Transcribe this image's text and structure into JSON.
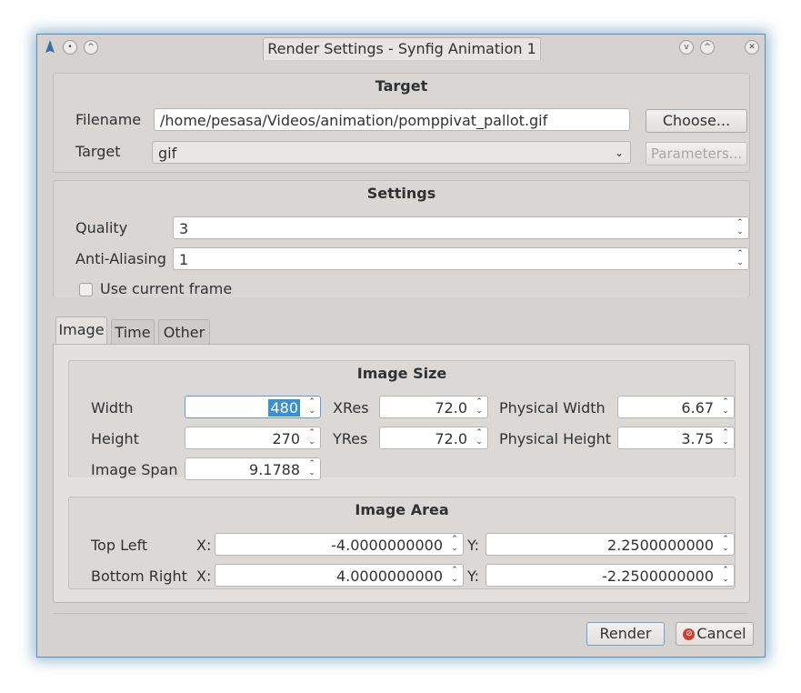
{
  "window": {
    "title": "Render Settings - Synfig Animation 1",
    "accent": "#5b8fbf"
  },
  "target_section": {
    "title": "Target",
    "filename_label": "Filename",
    "filename_value": "/home/pesasa/Videos/animation/pomppivat_pallot.gif",
    "choose_label": "Choose...",
    "target_label": "Target",
    "target_value": "gif",
    "parameters_label": "Parameters..."
  },
  "settings_section": {
    "title": "Settings",
    "quality_label": "Quality",
    "quality_value": "3",
    "antialiasing_label": "Anti-Aliasing",
    "antialiasing_value": "1",
    "use_current_frame_label": "Use current frame",
    "use_current_frame_checked": false
  },
  "tabs": [
    "Image",
    "Time",
    "Other"
  ],
  "active_tab": "Image",
  "image_size": {
    "title": "Image Size",
    "width_label": "Width",
    "width_value": "480",
    "height_label": "Height",
    "height_value": "270",
    "xres_label": "XRes",
    "xres_value": "72.0",
    "yres_label": "YRes",
    "yres_value": "72.0",
    "phys_width_label": "Physical Width",
    "phys_width_value": "6.67",
    "phys_height_label": "Physical Height",
    "phys_height_value": "3.75",
    "image_span_label": "Image Span",
    "image_span_value": "9.1788"
  },
  "image_area": {
    "title": "Image Area",
    "top_left_label": "Top Left",
    "bottom_right_label": "Bottom Right",
    "x_label": "X:",
    "y_label": "Y:",
    "tl_x": "-4.0000000000",
    "tl_y": "2.2500000000",
    "br_x": "4.0000000000",
    "br_y": "-2.2500000000"
  },
  "footer": {
    "render_label": "Render",
    "cancel_label": "Cancel"
  }
}
